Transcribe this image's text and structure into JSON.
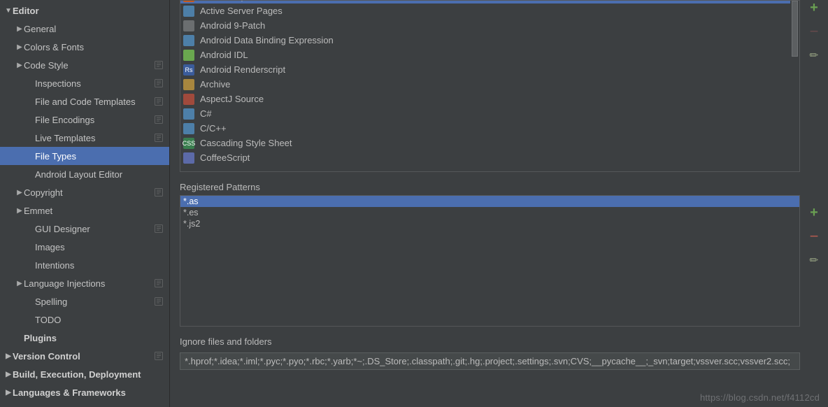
{
  "sidebar": {
    "items": [
      {
        "label": "Editor",
        "expand": "down",
        "bold": true,
        "indent": 0,
        "hint": false
      },
      {
        "label": "General",
        "expand": "right",
        "bold": false,
        "indent": 1,
        "hint": false
      },
      {
        "label": "Colors & Fonts",
        "expand": "right",
        "bold": false,
        "indent": 1,
        "hint": false
      },
      {
        "label": "Code Style",
        "expand": "right",
        "bold": false,
        "indent": 1,
        "hint": true
      },
      {
        "label": "Inspections",
        "expand": "",
        "bold": false,
        "indent": 2,
        "hint": true
      },
      {
        "label": "File and Code Templates",
        "expand": "",
        "bold": false,
        "indent": 2,
        "hint": true
      },
      {
        "label": "File Encodings",
        "expand": "",
        "bold": false,
        "indent": 2,
        "hint": true
      },
      {
        "label": "Live Templates",
        "expand": "",
        "bold": false,
        "indent": 2,
        "hint": true
      },
      {
        "label": "File Types",
        "expand": "",
        "bold": false,
        "indent": 2,
        "hint": false,
        "selected": true
      },
      {
        "label": "Android Layout Editor",
        "expand": "",
        "bold": false,
        "indent": 2,
        "hint": false
      },
      {
        "label": "Copyright",
        "expand": "right",
        "bold": false,
        "indent": 1,
        "hint": true
      },
      {
        "label": "Emmet",
        "expand": "right",
        "bold": false,
        "indent": 1,
        "hint": false
      },
      {
        "label": "GUI Designer",
        "expand": "",
        "bold": false,
        "indent": 2,
        "hint": true
      },
      {
        "label": "Images",
        "expand": "",
        "bold": false,
        "indent": 2,
        "hint": false
      },
      {
        "label": "Intentions",
        "expand": "",
        "bold": false,
        "indent": 2,
        "hint": false
      },
      {
        "label": "Language Injections",
        "expand": "right",
        "bold": false,
        "indent": 1,
        "hint": true
      },
      {
        "label": "Spelling",
        "expand": "",
        "bold": false,
        "indent": 2,
        "hint": true
      },
      {
        "label": "TODO",
        "expand": "",
        "bold": false,
        "indent": 2,
        "hint": false
      },
      {
        "label": "Plugins",
        "expand": "",
        "bold": true,
        "indent": 1,
        "hint": false
      },
      {
        "label": "Version Control",
        "expand": "right",
        "bold": true,
        "indent": 0,
        "hint": true
      },
      {
        "label": "Build, Execution, Deployment",
        "expand": "right",
        "bold": true,
        "indent": 0,
        "hint": false
      },
      {
        "label": "Languages & Frameworks",
        "expand": "right",
        "bold": true,
        "indent": 0,
        "hint": false
      }
    ]
  },
  "filetypes": [
    {
      "label": "ActionScript",
      "color": "#c65a21",
      "txt": "AS",
      "sel": true
    },
    {
      "label": "Active Server Pages",
      "color": "#4d7fa8",
      "txt": ""
    },
    {
      "label": "Android 9-Patch",
      "color": "#6b6e70",
      "txt": ""
    },
    {
      "label": "Android Data Binding Expression",
      "color": "#4d7fa8",
      "txt": ""
    },
    {
      "label": "Android IDL",
      "color": "#6aa84f",
      "txt": ""
    },
    {
      "label": "Android Renderscript",
      "color": "#3b5c9b",
      "txt": "Rs"
    },
    {
      "label": "Archive",
      "color": "#a8863e",
      "txt": ""
    },
    {
      "label": "AspectJ Source",
      "color": "#a04a3c",
      "txt": ""
    },
    {
      "label": "C#",
      "color": "#4d7fa8",
      "txt": ""
    },
    {
      "label": "C/C++",
      "color": "#4d7fa8",
      "txt": ""
    },
    {
      "label": "Cascading Style Sheet",
      "color": "#3a7e4f",
      "txt": "CSS"
    },
    {
      "label": "CoffeeScript",
      "color": "#5c6aa8",
      "txt": ""
    }
  ],
  "patterns_label": "Registered Patterns",
  "patterns": [
    {
      "label": "*.as",
      "sel": true
    },
    {
      "label": "*.es",
      "sel": false
    },
    {
      "label": "*.js2",
      "sel": false
    }
  ],
  "ignore_label": "Ignore files and folders",
  "ignore_value": "*.hprof;*.idea;*.iml;*.pyc;*.pyo;*.rbc;*.yarb;*~;.DS_Store;.classpath;.git;.hg;.project;.settings;.svn;CVS;__pycache__;_svn;target;vssver.scc;vssver2.scc;",
  "watermark": "https://blog.csdn.net/f4112cd",
  "watermark2": ""
}
